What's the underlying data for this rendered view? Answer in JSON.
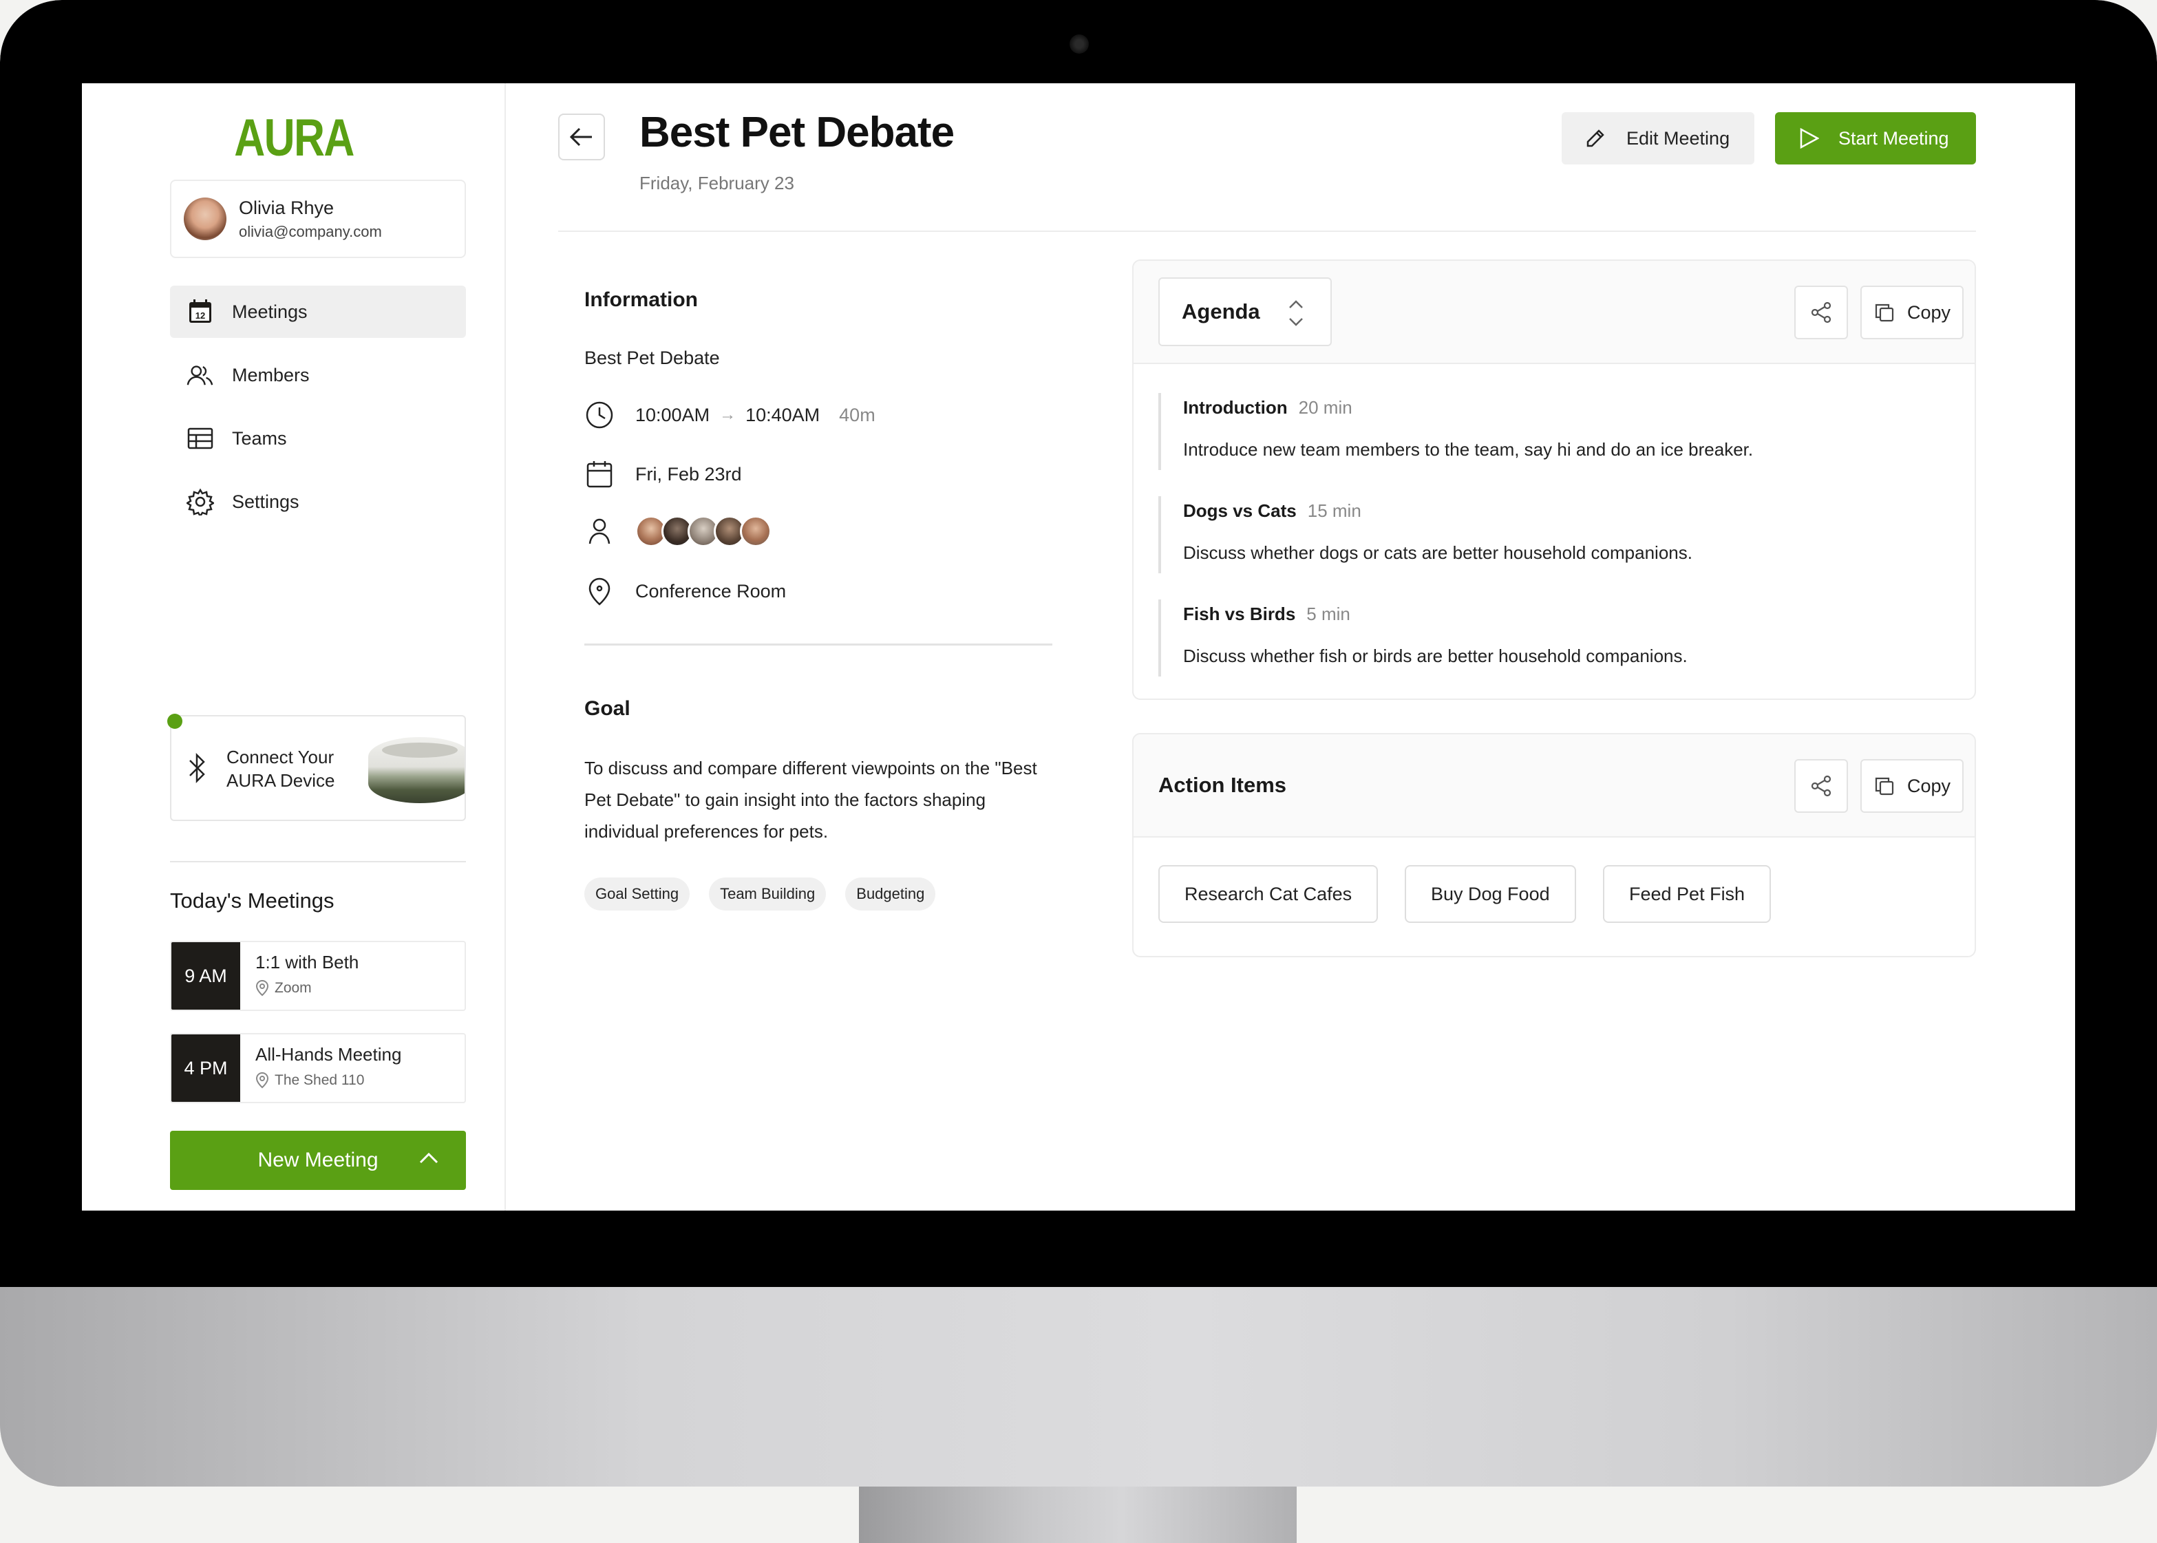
{
  "app": {
    "logo": "AURA"
  },
  "user": {
    "name": "Olivia Rhye",
    "email": "olivia@company.com"
  },
  "nav": [
    {
      "label": "Meetings",
      "icon": "calendar-icon",
      "active": true
    },
    {
      "label": "Members",
      "icon": "users-icon"
    },
    {
      "label": "Teams",
      "icon": "table-icon"
    },
    {
      "label": "Settings",
      "icon": "gear-icon"
    }
  ],
  "device": {
    "line1": "Connect Your",
    "line2": "AURA Device"
  },
  "today": {
    "title": "Today's Meetings",
    "meetings": [
      {
        "time": "9 AM",
        "title": "1:1 with Beth",
        "location": "Zoom"
      },
      {
        "time": "4 PM",
        "title": "All-Hands Meeting",
        "location": "The Shed 110"
      }
    ]
  },
  "new_meeting_label": "New Meeting",
  "header": {
    "title": "Best Pet Debate",
    "date": "Friday, February 23",
    "edit_label": "Edit Meeting",
    "start_label": "Start Meeting"
  },
  "information": {
    "title": "Information",
    "name": "Best Pet Debate",
    "start": "10:00AM",
    "end": "10:40AM",
    "duration": "40m",
    "date": "Fri, Feb 23rd",
    "location": "Conference Room"
  },
  "goal": {
    "title": "Goal",
    "text": "To discuss and compare different viewpoints on the \"Best Pet Debate\" to gain insight into the factors shaping individual preferences for pets.",
    "tags": [
      "Goal Setting",
      "Team Building",
      "Budgeting"
    ]
  },
  "agenda": {
    "select_label": "Agenda",
    "copy_label": "Copy",
    "items": [
      {
        "title": "Introduction",
        "duration": "20 min",
        "description": "Introduce new team members to the team, say hi and do an ice breaker."
      },
      {
        "title": "Dogs vs Cats",
        "duration": "15 min",
        "description": "Discuss whether dogs or cats are better household companions."
      },
      {
        "title": "Fish vs Birds",
        "duration": "5 min",
        "description": "Discuss whether fish or birds are better household companions."
      }
    ]
  },
  "action_items": {
    "title": "Action Items",
    "copy_label": "Copy",
    "items": [
      "Research Cat Cafes",
      "Buy Dog Food",
      "Feed Pet Fish"
    ]
  },
  "colors": {
    "accent": "#5aa014",
    "dark": "#1e1c19"
  }
}
